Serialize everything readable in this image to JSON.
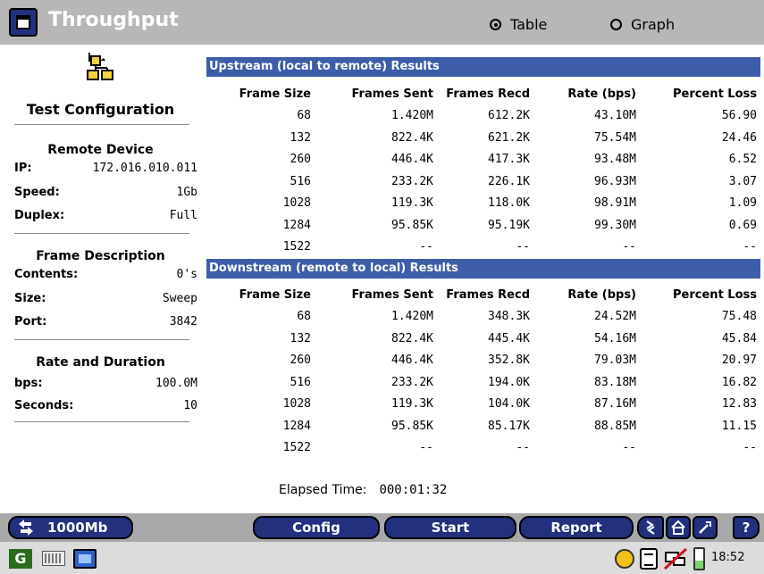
{
  "window": {
    "title": "Throughput",
    "view_options": [
      "Table",
      "Graph"
    ],
    "selected_view": "Table"
  },
  "config_panel": {
    "title": "Test Configuration",
    "remote_device": {
      "heading": "Remote Device",
      "ip_label": "IP:",
      "ip_value": "172.016.010.011",
      "speed_label": "Speed:",
      "speed_value": "1Gb",
      "duplex_label": "Duplex:",
      "duplex_value": "Full"
    },
    "frame_description": {
      "heading": "Frame Description",
      "contents_label": "Contents:",
      "contents_value": "0's",
      "size_label": "Size:",
      "size_value": "Sweep",
      "port_label": "Port:",
      "port_value": "3842"
    },
    "rate_duration": {
      "heading": "Rate and Duration",
      "bps_label": "bps:",
      "bps_value": "100.0M",
      "seconds_label": "Seconds:",
      "seconds_value": "10"
    }
  },
  "columns": [
    "Frame Size",
    "Frames Sent",
    "Frames Recd",
    "Rate (bps)",
    "Percent Loss"
  ],
  "upstream": {
    "title": "Upstream (local to remote) Results",
    "rows": [
      [
        "68",
        "1.420M",
        "612.2K",
        "43.10M",
        "56.90"
      ],
      [
        "132",
        "822.4K",
        "621.2K",
        "75.54M",
        "24.46"
      ],
      [
        "260",
        "446.4K",
        "417.3K",
        "93.48M",
        "6.52"
      ],
      [
        "516",
        "233.2K",
        "226.1K",
        "96.93M",
        "3.07"
      ],
      [
        "1028",
        "119.3K",
        "118.0K",
        "98.91M",
        "1.09"
      ],
      [
        "1284",
        "95.85K",
        "95.19K",
        "99.30M",
        "0.69"
      ],
      [
        "1522",
        "--",
        "--",
        "--",
        "--"
      ]
    ]
  },
  "downstream": {
    "title": "Downstream (remote to local) Results",
    "rows": [
      [
        "68",
        "1.420M",
        "348.3K",
        "24.52M",
        "75.48"
      ],
      [
        "132",
        "822.4K",
        "445.4K",
        "54.16M",
        "45.84"
      ],
      [
        "260",
        "446.4K",
        "352.8K",
        "79.03M",
        "20.97"
      ],
      [
        "516",
        "233.2K",
        "194.0K",
        "83.18M",
        "16.82"
      ],
      [
        "1028",
        "119.3K",
        "104.0K",
        "87.16M",
        "12.83"
      ],
      [
        "1284",
        "95.85K",
        "85.17K",
        "88.85M",
        "11.15"
      ],
      [
        "1522",
        "--",
        "--",
        "--",
        "--"
      ]
    ]
  },
  "elapsed": {
    "label": "Elapsed Time:",
    "value": "000:01:32"
  },
  "command_bar": {
    "link_label": "1000Mb",
    "config_label": "Config",
    "start_label": "Start",
    "report_label": "Report",
    "help_label": "?"
  },
  "tray": {
    "clock": "18:52"
  },
  "colors": {
    "titlebar": "#b7b7b7",
    "section_bar": "#3d5da9",
    "button": "#22307e",
    "command_bar": "#a9a9a9"
  }
}
